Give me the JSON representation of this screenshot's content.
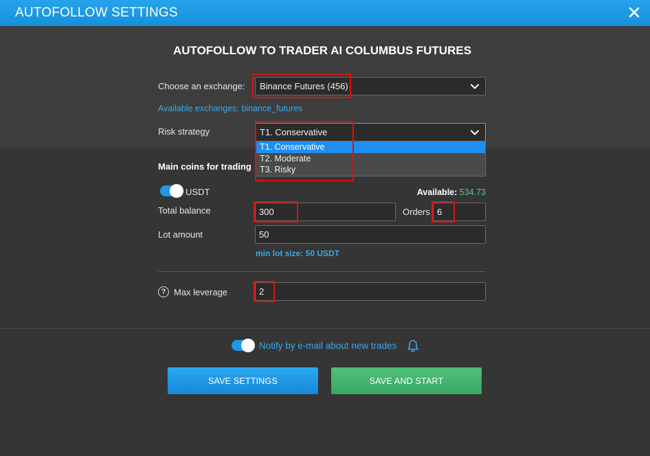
{
  "window": {
    "title": "AUTOFOLLOW SETTINGS"
  },
  "heading": "AUTOFOLLOW TO TRADER AI COLUMBUS FUTURES",
  "exchange": {
    "label": "Choose an exchange:",
    "selected": "Binance Futures (456)",
    "available_text": "Available exchanges: binance_futures"
  },
  "risk": {
    "label": "Risk strategy",
    "selected": "T1. Conservative",
    "options": [
      "T1. Conservative",
      "T2. Moderate",
      "T3. Risky"
    ]
  },
  "main_coins": {
    "label": "Main coins for trading",
    "coin_toggle_label": "USDT",
    "coin_toggle_on": true,
    "available_label": "Available:",
    "available_value": "534.73"
  },
  "fields": {
    "total_balance_label": "Total balance",
    "total_balance_value": "300",
    "orders_label": "Orders",
    "orders_value": "6",
    "lot_amount_label": "Lot amount",
    "lot_amount_value": "50",
    "min_lot_text": "min lot size: 50 USDT",
    "max_leverage_label": "Max leverage",
    "max_leverage_value": "2"
  },
  "notify": {
    "label": "Notify by e-mail about new trades",
    "on": true
  },
  "buttons": {
    "save_settings": "SAVE SETTINGS",
    "save_and_start": "SAVE AND START"
  },
  "colors": {
    "accent_blue": "#1f97ea",
    "accent_green": "#4fbf7a",
    "highlight_red": "#dd1111",
    "background": "#353535"
  }
}
